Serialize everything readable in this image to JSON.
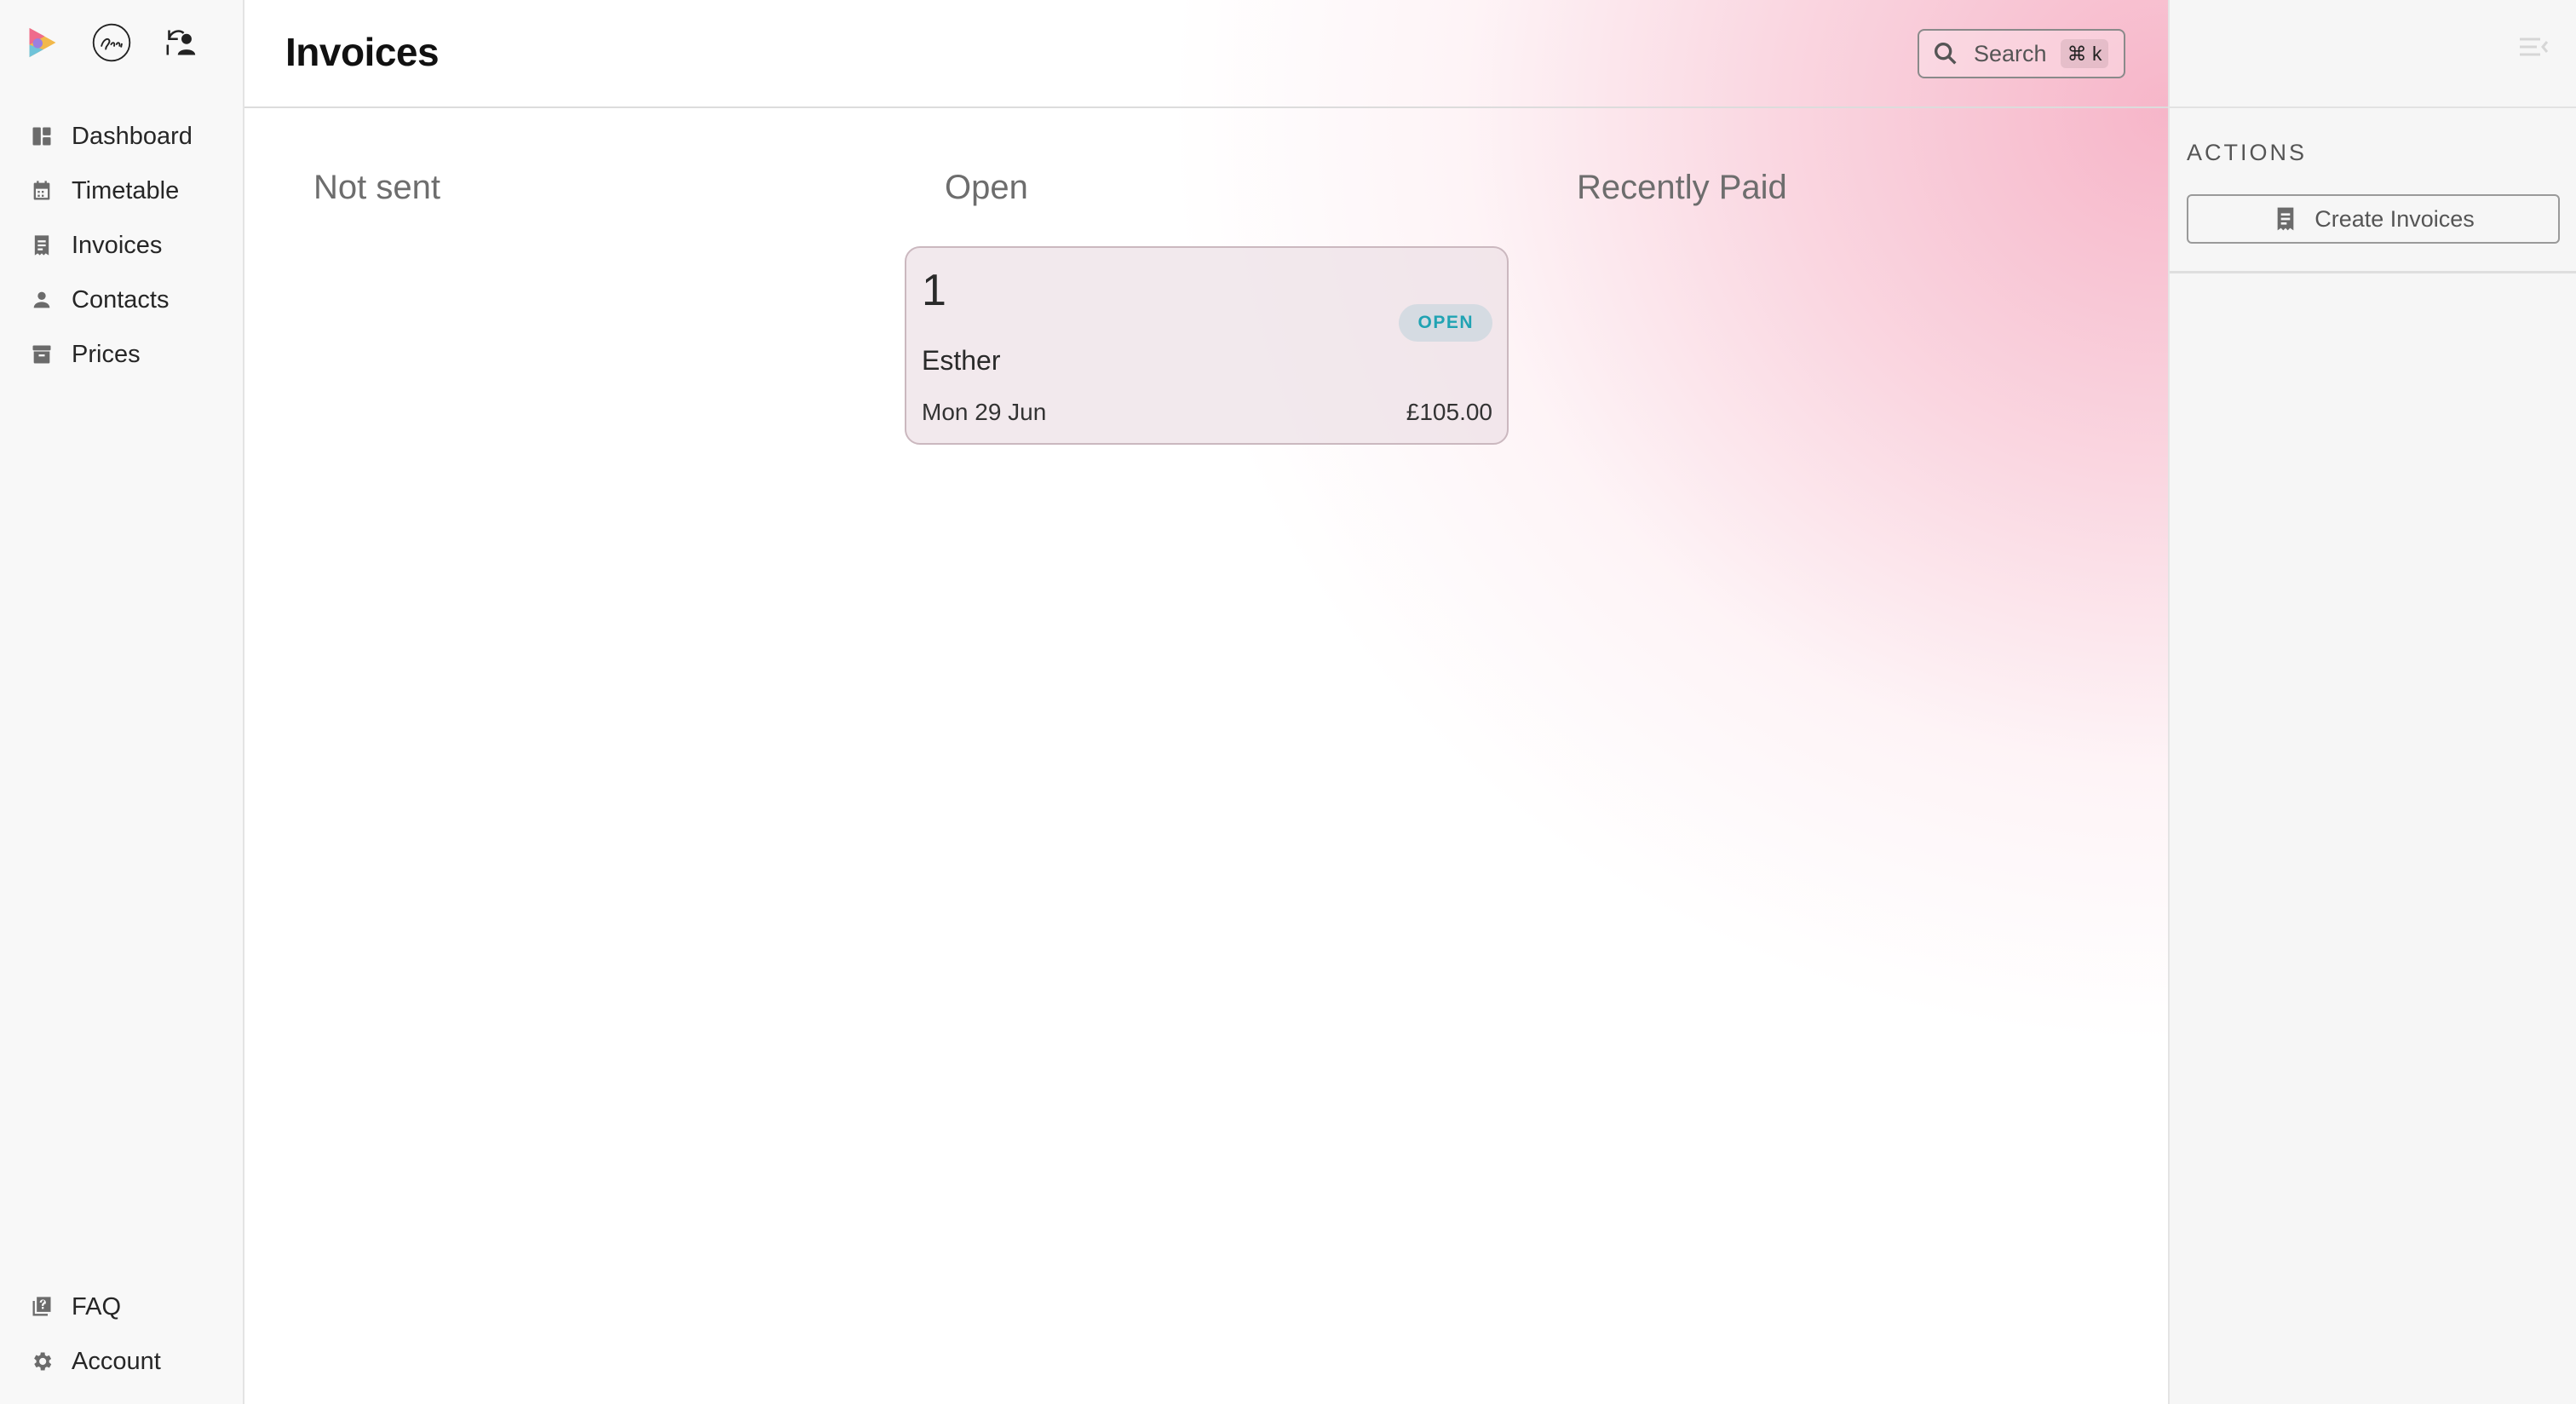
{
  "page": {
    "title": "Invoices"
  },
  "sidebar": {
    "items": [
      {
        "label": "Dashboard",
        "icon": "dashboard-icon"
      },
      {
        "label": "Timetable",
        "icon": "calendar-icon"
      },
      {
        "label": "Invoices",
        "icon": "receipt-icon"
      },
      {
        "label": "Contacts",
        "icon": "person-icon"
      },
      {
        "label": "Prices",
        "icon": "archive-box-icon"
      }
    ],
    "bottom_items": [
      {
        "label": "FAQ",
        "icon": "help-book-icon"
      },
      {
        "label": "Account",
        "icon": "gear-icon"
      }
    ]
  },
  "search": {
    "label": "Search",
    "shortcut": "⌘ k"
  },
  "columns": [
    "Not sent",
    "Open",
    "Recently Paid"
  ],
  "invoice": {
    "number": "1",
    "status": "OPEN",
    "contact": "Esther",
    "date": "Mon 29 Jun",
    "amount": "£105.00"
  },
  "actions": {
    "title": "ACTIONS",
    "create_label": "Create Invoices"
  },
  "colors": {
    "accent_pink": "#f6b2c6",
    "status_open": "#20a3b3"
  }
}
